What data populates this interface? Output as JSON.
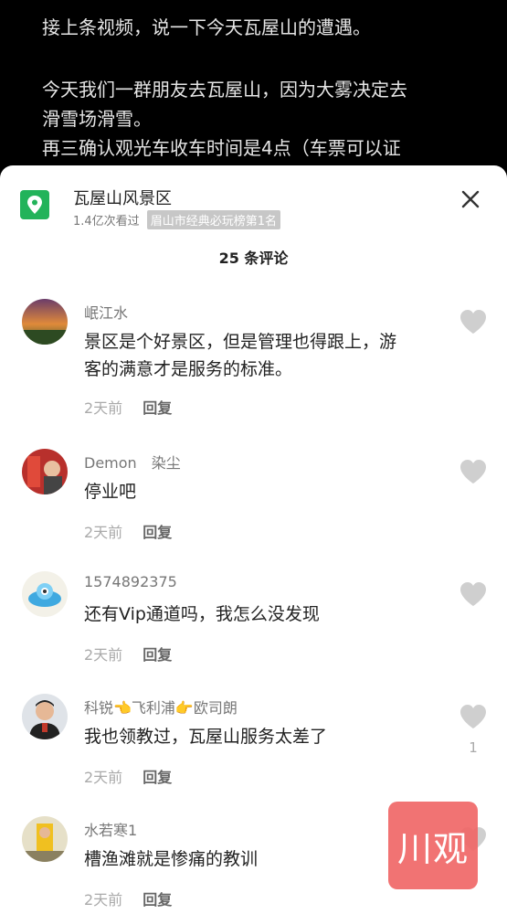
{
  "post": {
    "line1": "接上条视频，说一下今天瓦屋山的遭遇。",
    "line2": "今天我们一群朋友去瓦屋山，因为大雾决定去",
    "line3": "滑雪场滑雪。",
    "line4": "再三确认观光车收车时间是4点（车票可以证"
  },
  "place": {
    "name": "瓦屋山风景区",
    "views": "1.4亿次看过",
    "rank": "眉山市经典必玩榜第1名",
    "icon": "location-pin-icon"
  },
  "comments_header": "25 条评论",
  "comments": [
    {
      "user": "岷江水",
      "user_extra": "",
      "text": "景区是个好景区，但是管理也得跟上，游客的满意才是服务的标准。",
      "time": "2天前",
      "reply": "回复",
      "likes": ""
    },
    {
      "user": "Demon",
      "user_extra": "染尘",
      "text": "停业吧",
      "time": "2天前",
      "reply": "回复",
      "likes": ""
    },
    {
      "user": "1574892375",
      "user_extra": "",
      "text": "还有Vip通道吗，我怎么没发现",
      "time": "2天前",
      "reply": "回复",
      "likes": ""
    },
    {
      "user": "科锐👈飞利浦👉欧司朗",
      "user_extra": "",
      "text": "我也领教过，瓦屋山服务太差了",
      "time": "2天前",
      "reply": "回复",
      "likes": "1"
    },
    {
      "user": "水若寒1",
      "user_extra": "",
      "text": "槽渔滩就是惨痛的教训",
      "time": "2天前",
      "reply": "回复",
      "likes": ""
    }
  ],
  "watermark": "川观",
  "colors": {
    "accent_green": "#22b35a",
    "watermark_bg": "#f06464"
  }
}
